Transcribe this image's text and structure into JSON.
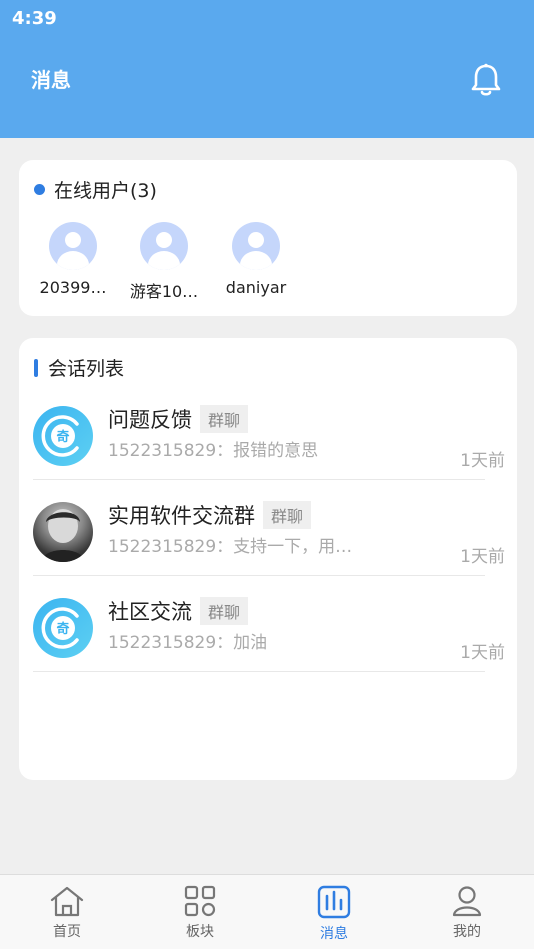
{
  "status_bar": {
    "time": "4:39"
  },
  "header": {
    "title": "消息"
  },
  "online": {
    "title": "在线用户(3)",
    "users": [
      {
        "name": "20399…"
      },
      {
        "name": "游客10…"
      },
      {
        "name": "daniyar"
      }
    ]
  },
  "sessions": {
    "title": "会话列表",
    "items": [
      {
        "name": "问题反馈",
        "tag": "群聊",
        "message": "1522315829：报错的意思",
        "time": "1天前",
        "avatar": "logo-icon"
      },
      {
        "name": "实用软件交流群",
        "tag": "群聊",
        "message": "1522315829：支持一下，用…",
        "time": "1天前",
        "avatar": "user-photo"
      },
      {
        "name": "社区交流",
        "tag": "群聊",
        "message": "1522315829：加油",
        "time": "1天前",
        "avatar": "logo-icon"
      }
    ]
  },
  "bottom_nav": {
    "items": [
      {
        "label": "首页",
        "icon": "home-icon"
      },
      {
        "label": "板块",
        "icon": "grid-icon"
      },
      {
        "label": "消息",
        "icon": "message-icon",
        "active": true
      },
      {
        "label": "我的",
        "icon": "user-icon"
      }
    ]
  },
  "colors": {
    "header": "#5aa9ee",
    "accent": "#2f7de1",
    "background": "#efefef"
  }
}
